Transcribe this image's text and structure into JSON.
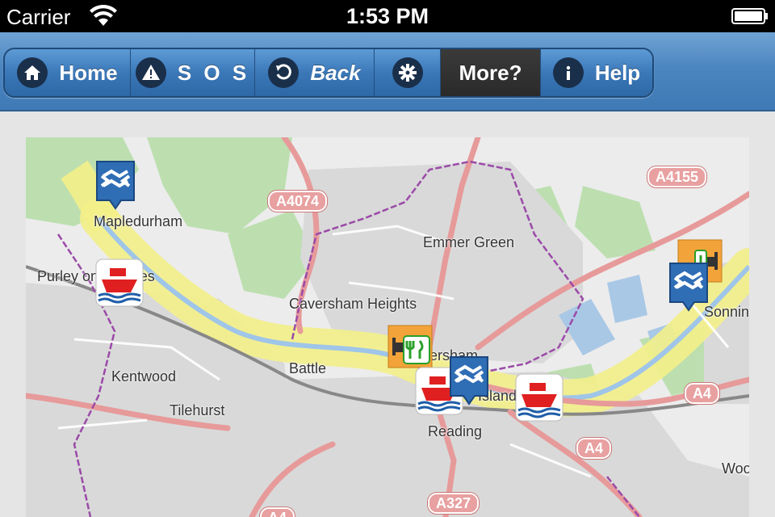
{
  "status_bar": {
    "carrier": "Carrier",
    "time": "1:53 PM"
  },
  "toolbar": {
    "home_label": "Home",
    "sos_label": "S O S",
    "back_label": "Back",
    "more_label": "More?",
    "help_label": "Help",
    "active": "more"
  },
  "map": {
    "places": {
      "mapledurham": "Mapledurham",
      "purley": "Purley on Thames",
      "emmer_green": "Emmer Green",
      "caversham_heights": "Caversham Heights",
      "caversham": "Caversham",
      "battle": "Battle",
      "kentwood": "Kentwood",
      "tilehurst": "Tilehurst",
      "reading": "Reading",
      "island": "Island",
      "sonning": "Sonning",
      "woodley": "Woodley"
    },
    "roads": {
      "a4074": "A4074",
      "a4155": "A4155",
      "a4_east": "A4",
      "a4_south": "A4",
      "a327": "A327",
      "a4_bottom": "A4"
    },
    "markers": [
      "lock-icon",
      "boat-hire-icon",
      "food-lodging-icon",
      "boat-hire-icon",
      "lock-icon",
      "boat-hire-icon",
      "food-lodging-icon",
      "lock-icon"
    ],
    "colors": {
      "river": "#f3f08a",
      "boundary": "#9b4aa8",
      "road_major": "#e79a9a",
      "park": "#b8deaa"
    }
  }
}
